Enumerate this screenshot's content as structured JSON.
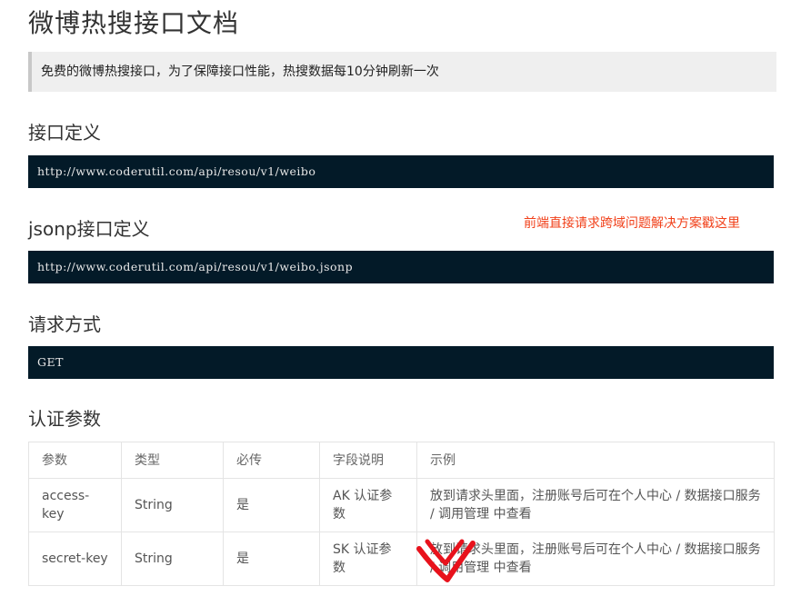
{
  "page": {
    "title": "微博热搜接口文档",
    "notice": "免费的微博热搜接口，为了保障接口性能，热搜数据每10分钟刷新一次"
  },
  "sections": {
    "api_definition": {
      "title": "接口定义",
      "url": "http://www.coderutil.com/api/resou/v1/weibo"
    },
    "jsonp_definition": {
      "title": "jsonp接口定义",
      "url": "http://www.coderutil.com/api/resou/v1/weibo.jsonp",
      "cors_link": "前端直接请求跨域问题解决方案戳这里"
    },
    "request_method": {
      "title": "请求方式",
      "value": "GET"
    },
    "auth_params": {
      "title": "认证参数",
      "headers": [
        "参数",
        "类型",
        "必传",
        "字段说明",
        "示例"
      ],
      "rows": [
        [
          "access-key",
          "String",
          "是",
          "AK 认证参数",
          "放到请求头里面，注册账号后可在个人中心 / 数据接口服务 / 调用管理 中查看"
        ],
        [
          "secret-key",
          "String",
          "是",
          "SK 认证参数",
          "放到请求头里面，注册账号后可在个人中心 / 数据接口服务 / 调用管理 中查看"
        ]
      ]
    }
  },
  "colors": {
    "code_bg": "#031a28",
    "link": "#f1401a",
    "annotation": "#e8121c"
  }
}
